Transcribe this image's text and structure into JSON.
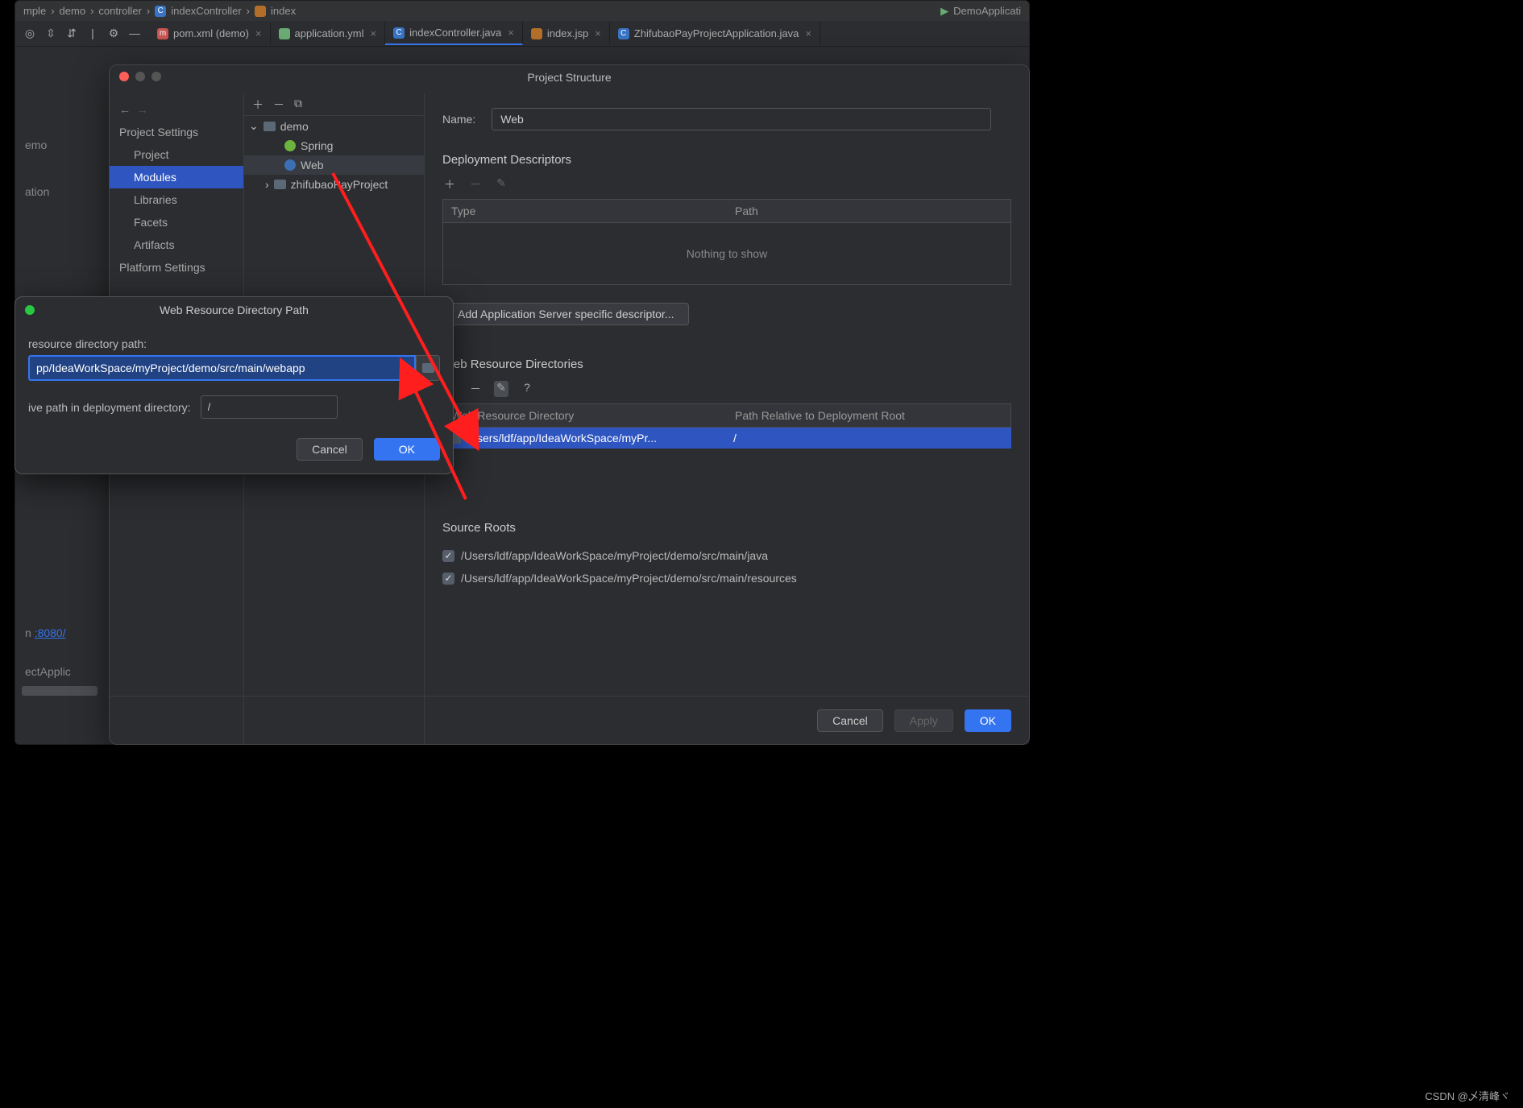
{
  "breadcrumb": {
    "seg1": "mple",
    "seg2": "demo",
    "seg3": "controller",
    "seg4": "indexController",
    "seg5": "index",
    "run": "DemoApplicati"
  },
  "tabs": {
    "t1": "pom.xml (demo)",
    "t2": "application.yml",
    "t3": "indexController.java",
    "t4": "index.jsp",
    "t5": "ZhifubaoPayProjectApplication.java"
  },
  "left": {
    "l1": "emo",
    "l2": "ation",
    "l3": "n ",
    "port": ":8080/",
    "l4": "ectApplic"
  },
  "ps": {
    "title": "Project Structure",
    "nav": {
      "hdr1": "Project Settings",
      "i1": "Project",
      "i2": "Modules",
      "i3": "Libraries",
      "i4": "Facets",
      "i5": "Artifacts",
      "hdr2": "Platform Settings"
    },
    "tree": {
      "n1": "demo",
      "n2": "Spring",
      "n3": "Web",
      "n4": "zhifubaoPayProject"
    },
    "main": {
      "name_lbl": "Name:",
      "name_val": "Web",
      "dd_hdr": "Deployment Descriptors",
      "type": "Type",
      "path": "Path",
      "nts": "Nothing to show",
      "addsrv": "Add Application Server specific descriptor...",
      "wrd_hdr": "Web Resource Directories",
      "wrd_col1": "Web Resource Directory",
      "wrd_col2": "Path Relative to Deployment Root",
      "wrd_val1": "/Users/ldf/app/IdeaWorkSpace/myPr...",
      "wrd_val2": "/",
      "sr_hdr": "Source Roots",
      "sr1": "/Users/ldf/app/IdeaWorkSpace/myProject/demo/src/main/java",
      "sr2": "/Users/ldf/app/IdeaWorkSpace/myProject/demo/src/main/resources"
    },
    "footer": {
      "cancel": "Cancel",
      "apply": "Apply",
      "ok": "OK"
    }
  },
  "sm": {
    "title": "Web Resource Directory Path",
    "lbl1": "resource directory path:",
    "path": "pp/IdeaWorkSpace/myProject/demo/src/main/webapp",
    "lbl2": "ive path in deployment directory:",
    "rel": "/",
    "cancel": "Cancel",
    "ok": "OK"
  },
  "watermark": "CSDN @乄清峰ヾ"
}
